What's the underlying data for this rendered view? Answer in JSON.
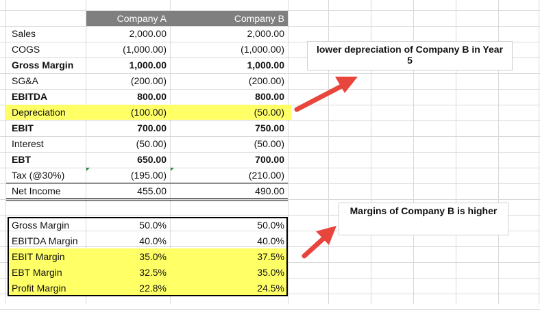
{
  "columns": {
    "a": "Company A",
    "b": "Company B"
  },
  "income_rows": [
    {
      "label": "Sales",
      "a": "2,000.00",
      "b": "2,000.00",
      "bold": false
    },
    {
      "label": "COGS",
      "a": "(1,000.00)",
      "b": "(1,000.00)",
      "bold": false
    },
    {
      "label": "Gross Margin",
      "a": "1,000.00",
      "b": "1,000.00",
      "bold": true
    },
    {
      "label": "SG&A",
      "a": "(200.00)",
      "b": "(200.00)",
      "bold": false
    },
    {
      "label": "EBITDA",
      "a": "800.00",
      "b": "800.00",
      "bold": true
    },
    {
      "label": "Depreciation",
      "a": "(100.00)",
      "b": "(50.00)",
      "bold": false
    },
    {
      "label": "EBIT",
      "a": "700.00",
      "b": "750.00",
      "bold": true
    },
    {
      "label": "Interest",
      "a": "(50.00)",
      "b": "(50.00)",
      "bold": false
    },
    {
      "label": "EBT",
      "a": "650.00",
      "b": "700.00",
      "bold": true
    },
    {
      "label": "Tax (@30%)",
      "a": "(195.00)",
      "b": "(210.00)",
      "bold": false
    },
    {
      "label": "Net Income",
      "a": "455.00",
      "b": "490.00",
      "bold": false
    }
  ],
  "margin_rows": [
    {
      "label": "Gross Margin",
      "a": "50.0%",
      "b": "50.0%"
    },
    {
      "label": "EBITDA Margin",
      "a": "40.0%",
      "b": "40.0%"
    },
    {
      "label": "EBIT Margin",
      "a": "35.0%",
      "b": "37.5%"
    },
    {
      "label": "EBT Margin",
      "a": "32.5%",
      "b": "35.0%"
    },
    {
      "label": "Profit Margin",
      "a": "22.8%",
      "b": "24.5%"
    }
  ],
  "notes": {
    "depreciation": "lower depreciation of Company B in Year 5",
    "margins": "Margins of Company B is higher"
  },
  "colors": {
    "highlight": "#ffff66",
    "arrow": "#e8453c",
    "header": "#7f7f7f"
  }
}
